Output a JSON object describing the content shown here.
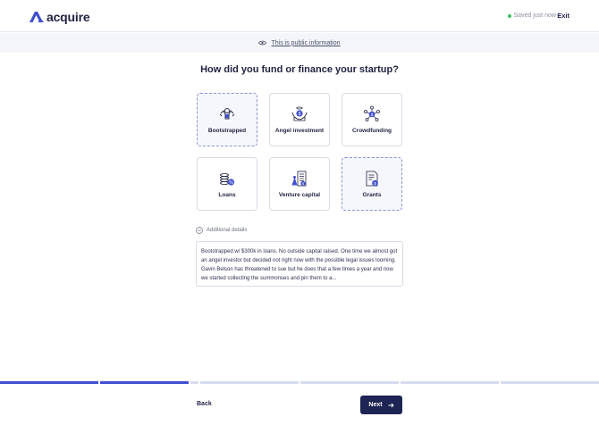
{
  "header": {
    "logo_text": "acquire",
    "saved_text": "Saved just now",
    "exit_label": "Exit"
  },
  "public_bar": {
    "link_text": "This is public information",
    "icon": "eye-icon"
  },
  "question": {
    "title": "How did you fund or finance your startup?"
  },
  "options": [
    {
      "label": "Bootstrapped",
      "icon": "bootstrapped-icon",
      "selected": true
    },
    {
      "label": "Angel investment",
      "icon": "angel-investment-icon",
      "selected": false
    },
    {
      "label": "Crowdfunding",
      "icon": "crowdfunding-icon",
      "selected": false
    },
    {
      "label": "Loans",
      "icon": "loans-icon",
      "selected": false
    },
    {
      "label": "Venture capital",
      "icon": "venture-capital-icon",
      "selected": false
    },
    {
      "label": "Grants",
      "icon": "grants-icon",
      "selected": true
    }
  ],
  "additional": {
    "label": "Additional details",
    "text": "Bootstrapped w/ $300k in loans. No outside capital raised. One time we almost got an angel investor but decided not right now with the possible legal issues looming. Gavin Belson has threatened to sue but he does that a few times a year and now we started collecting the summonses and pin them to a..."
  },
  "progress": {
    "segments": 6,
    "completed": 2
  },
  "footer": {
    "back_label": "Back",
    "next_label": "Next"
  },
  "colors": {
    "brand": "#3f4ed0",
    "navy": "#1e2453",
    "saved_dot": "#3fbf5d"
  }
}
